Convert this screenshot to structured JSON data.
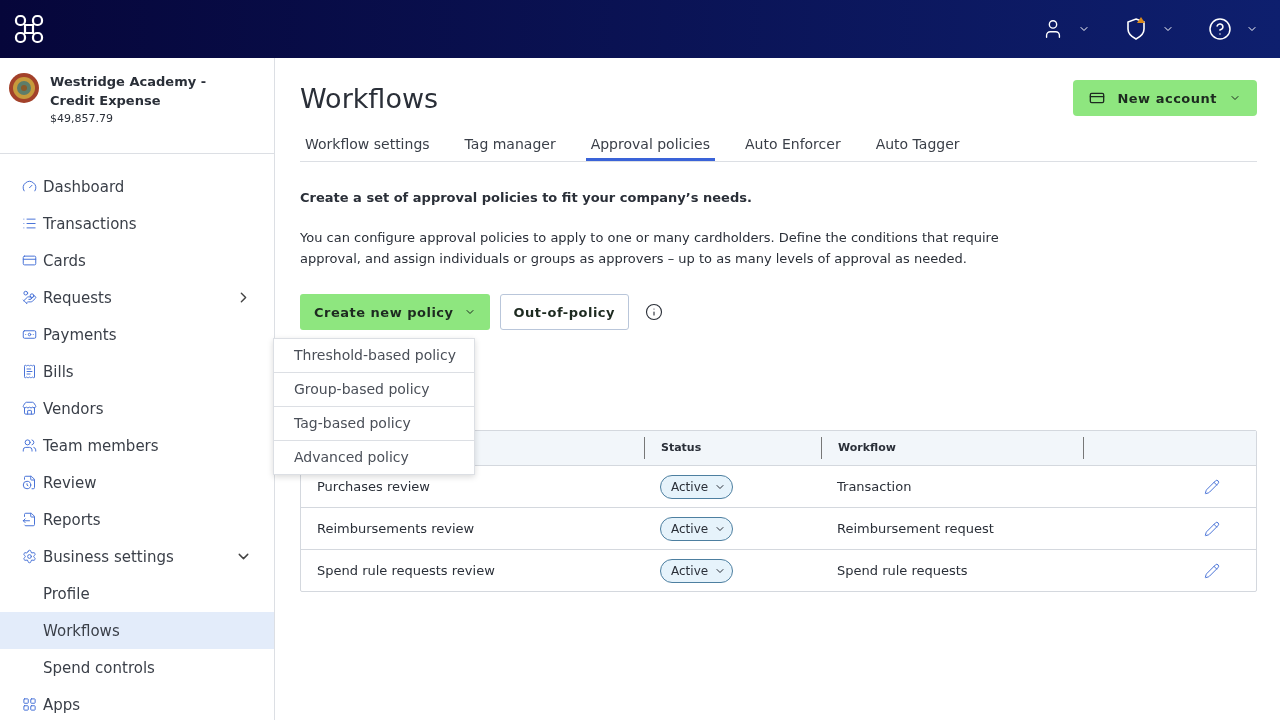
{
  "org": {
    "name": "Westridge Academy - Credit Expense",
    "balance": "$49,857.79"
  },
  "sidebar": {
    "items": [
      {
        "label": "Dashboard"
      },
      {
        "label": "Transactions"
      },
      {
        "label": "Cards"
      },
      {
        "label": "Requests",
        "expanded": false
      },
      {
        "label": "Payments"
      },
      {
        "label": "Bills"
      },
      {
        "label": "Vendors"
      },
      {
        "label": "Team members"
      },
      {
        "label": "Review"
      },
      {
        "label": "Reports"
      },
      {
        "label": "Business settings",
        "expanded": true,
        "children": [
          {
            "label": "Profile",
            "selected": false
          },
          {
            "label": "Workflows",
            "selected": true
          },
          {
            "label": "Spend controls",
            "selected": false
          }
        ]
      },
      {
        "label": "Apps"
      }
    ]
  },
  "page": {
    "title": "Workflows",
    "new_account": "New account"
  },
  "tabs": [
    {
      "label": "Workflow settings",
      "selected": false
    },
    {
      "label": "Tag manager",
      "selected": false
    },
    {
      "label": "Approval policies",
      "selected": true
    },
    {
      "label": "Auto Enforcer",
      "selected": false
    },
    {
      "label": "Auto Tagger",
      "selected": false
    }
  ],
  "intro": {
    "heading": "Create a set of approval policies to fit your company’s needs.",
    "body": "You can configure approval policies to apply to one or many cardholders. Define the conditions that require approval, and assign individuals or groups as approvers – up to as many levels of approval as needed."
  },
  "actions": {
    "create": "Create new policy",
    "out_of_policy": "Out-of-policy"
  },
  "menu": [
    "Threshold-based policy",
    "Group-based policy",
    "Tag-based policy",
    "Advanced policy"
  ],
  "table": {
    "columns": [
      "Status",
      "Workflow"
    ],
    "rows": [
      {
        "name": "Purchases review",
        "status": "Active",
        "workflow": "Transaction"
      },
      {
        "name": "Reimbursements review",
        "status": "Active",
        "workflow": "Reimbursement request"
      },
      {
        "name": "Spend rule requests review",
        "status": "Active",
        "workflow": "Spend rule requests"
      }
    ]
  }
}
